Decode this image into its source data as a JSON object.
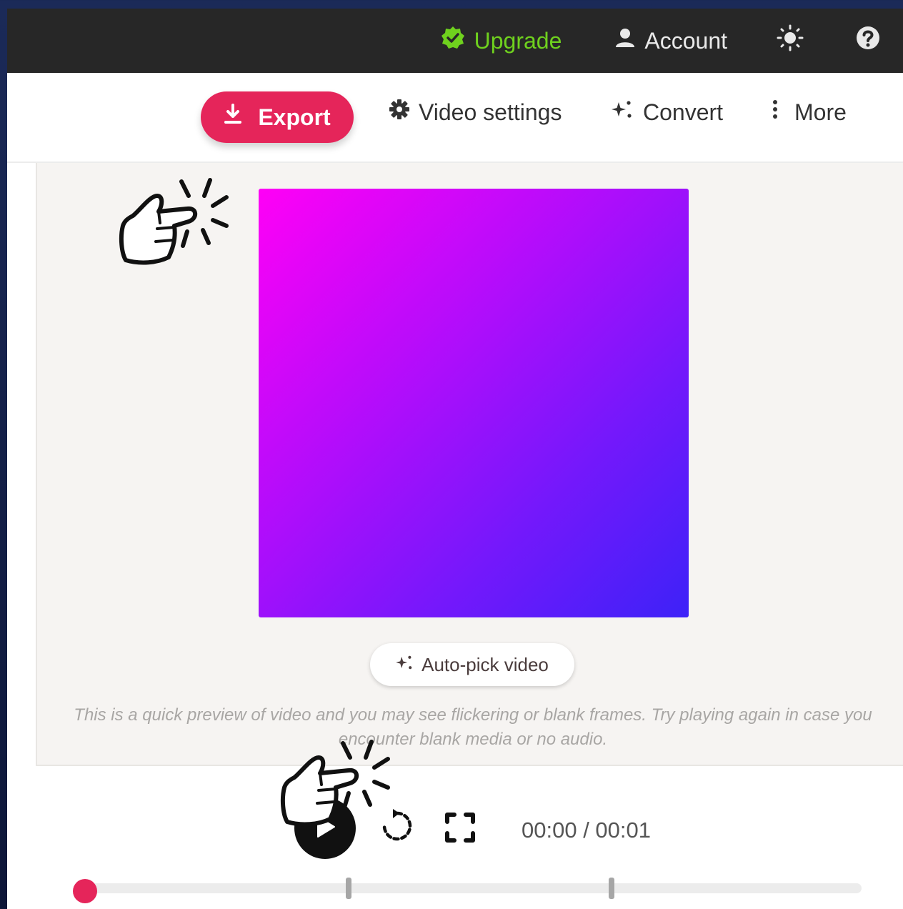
{
  "topbar": {
    "upgrade_label": "Upgrade",
    "account_label": "Account"
  },
  "toolbar": {
    "export_label": "Export",
    "video_settings_label": "Video settings",
    "convert_label": "Convert",
    "more_label": "More"
  },
  "preview": {
    "autopick_label": "Auto-pick video",
    "notice": "This is a quick preview of video and you may see flickering or blank frames. Try playing again in case you encounter blank media or no audio."
  },
  "player": {
    "time": "00:00 / 00:01",
    "progress_fraction": 0
  },
  "colors": {
    "accent": "#e5255a",
    "upgrade_green": "#6fd11e",
    "topbar_bg": "#272727",
    "video_gradient_start": "#ff00f6",
    "video_gradient_end": "#3d22f8"
  },
  "icons": {
    "upgrade": "verified-badge-icon",
    "account": "user-icon",
    "theme": "sun-icon",
    "help": "help-circle-icon",
    "export": "download-icon",
    "video_settings": "gear-icon",
    "convert": "sparkle-icon",
    "more": "more-vertical-icon",
    "autopick": "sparkle-icon",
    "play": "play-icon",
    "replay": "replay-icon",
    "fullscreen": "fullscreen-icon",
    "tutorial_pointer": "pointing-hand-icon"
  }
}
